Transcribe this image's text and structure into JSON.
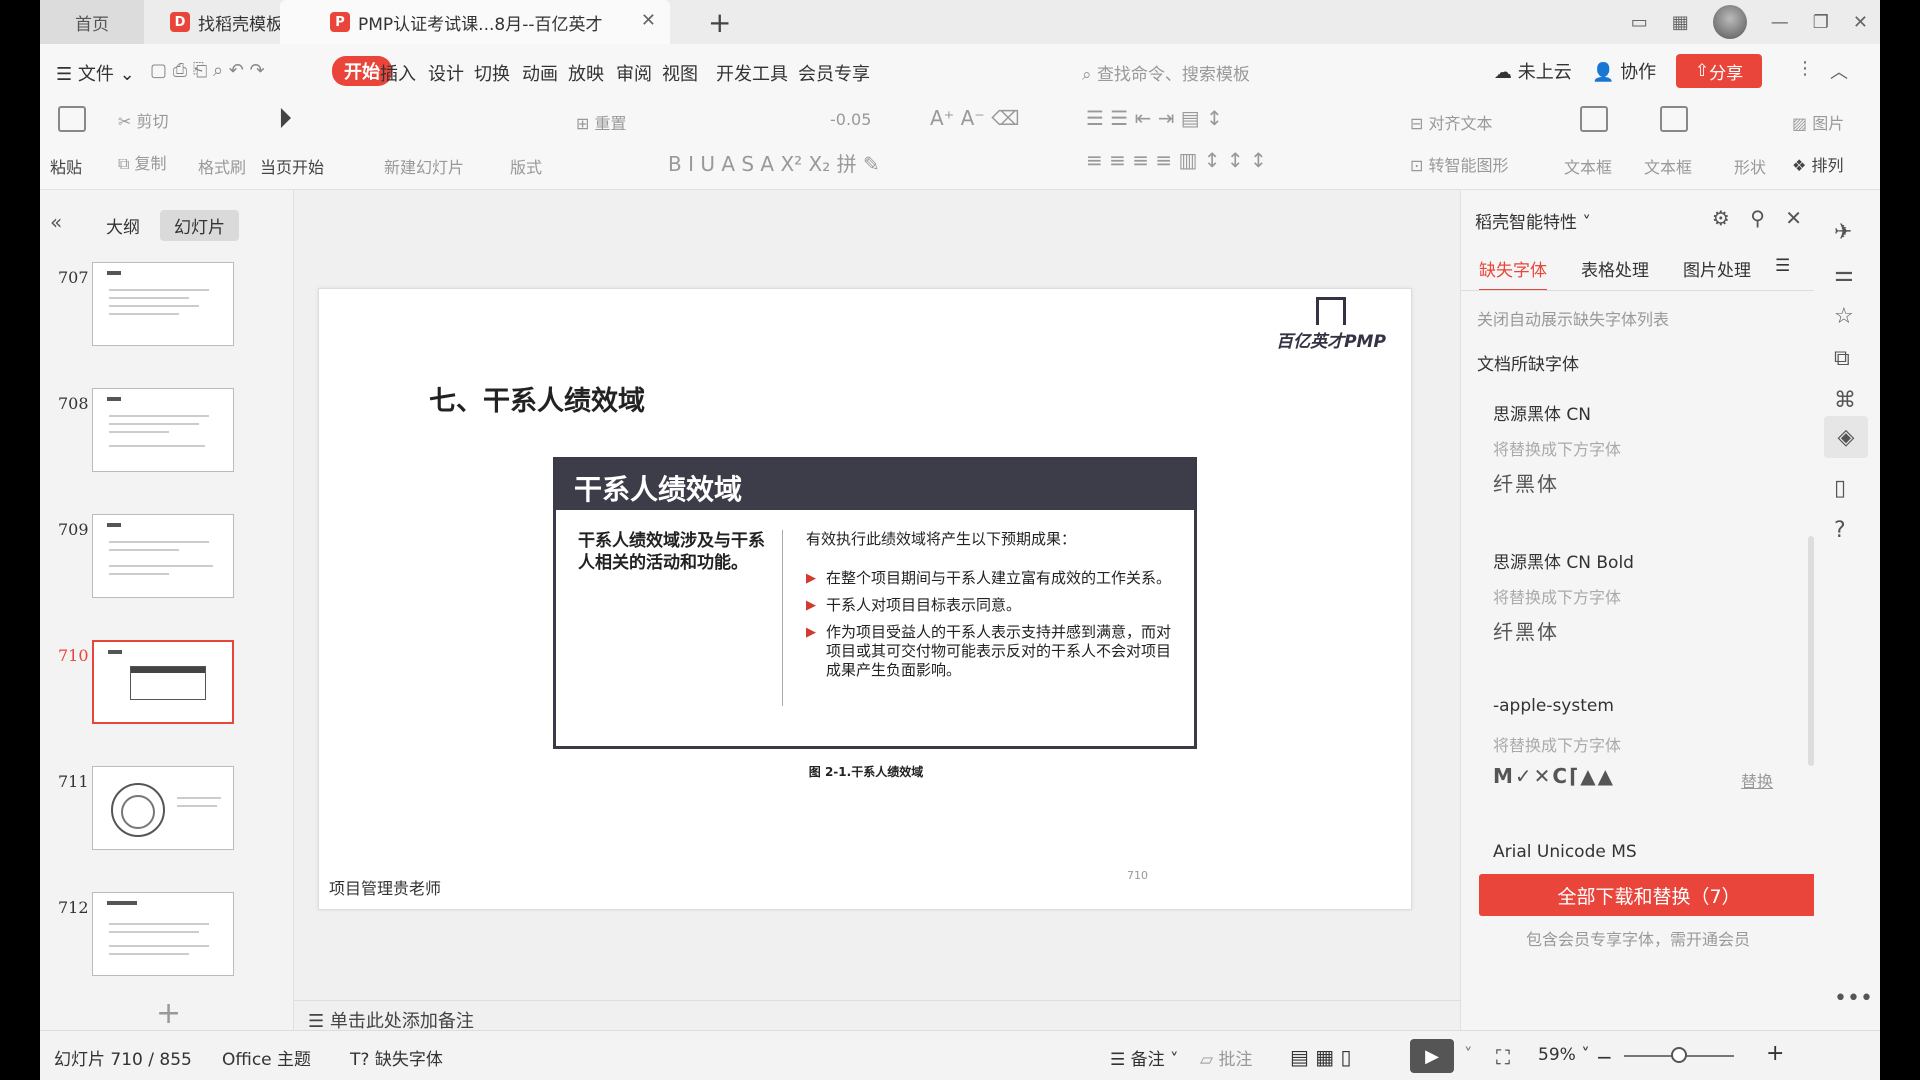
{
  "titlebar": {
    "home_tab": "首页",
    "template_tab": "找稻壳模板",
    "doc_tab": "PMP认证考试课...8月--百亿英才"
  },
  "menubar": {
    "file": "文件",
    "items": [
      "开始",
      "插入",
      "设计",
      "切换",
      "动画",
      "放映",
      "审阅",
      "视图",
      "开发工具",
      "会员专享"
    ],
    "search_placeholder": "查找命令、搜索模板",
    "cloud": "未上云",
    "collab": "协作",
    "share": "分享"
  },
  "ribbon": {
    "paste": "粘贴",
    "cut": "剪切",
    "copy": "复制",
    "format_painter": "格式刷",
    "play_current": "当页开始",
    "new_slide": "新建幻灯片",
    "layout": "版式",
    "reset": "重置",
    "font_size_delta": "-0.05",
    "align_text": "对齐文本",
    "smart_shape": "转智能图形",
    "textbox": "文本框",
    "textbox2": "文本框",
    "shape": "形状",
    "picture": "图片",
    "arrange": "排列"
  },
  "leftpanel": {
    "tab_outline": "大纲",
    "tab_slides": "幻灯片",
    "thumbnails": [
      {
        "num": "707"
      },
      {
        "num": "708"
      },
      {
        "num": "709"
      },
      {
        "num": "710",
        "selected": true
      },
      {
        "num": "711"
      },
      {
        "num": "712"
      }
    ]
  },
  "slide": {
    "logo_text": "百亿英才PMP",
    "title": "七、干系人绩效域",
    "box_header": "干系人绩效域",
    "box_left": "干系人绩效域涉及与干系人相关的活动和功能。",
    "box_intro": "有效执行此绩效域将产生以下预期成果：",
    "bullets": [
      "在整个项目期间与干系人建立富有成效的工作关系。",
      "干系人对项目目标表示同意。",
      "作为项目受益人的干系人表示支持并感到满意，而对项目或其可交付物可能表示反对的干系人不会对项目成果产生负面影响。"
    ],
    "caption": "图 2-1.干系人绩效域",
    "footer": "项目管理贵老师",
    "page_num": "710"
  },
  "notes": {
    "placeholder": "单击此处添加备注"
  },
  "rightpanel": {
    "title": "稻壳智能特性",
    "tabs": [
      "缺失字体",
      "表格处理",
      "图片处理"
    ],
    "close_auto_link": "关闭自动展示缺失字体列表",
    "section_title": "文档所缺字体",
    "fonts": [
      {
        "name": "思源黑体 CN",
        "hint": "将替换成下方字体",
        "replacement": "纤黑体"
      },
      {
        "name": "思源黑体 CN Bold",
        "hint": "将替换成下方字体",
        "replacement": "纤黑体"
      },
      {
        "name": "-apple-system",
        "hint": "将替换成下方字体",
        "replacement": "M✓✕C⌈▲▲",
        "action": "替换"
      },
      {
        "name": "Arial Unicode MS"
      }
    ],
    "download_button": "全部下载和替换（7）",
    "member_note": "包含会员专享字体，需开通会员"
  },
  "statusbar": {
    "slide_info": "幻灯片 710 / 855",
    "theme": "Office 主题",
    "missing_font": "缺失字体",
    "notes": "备注",
    "comments": "批注",
    "zoom": "59%",
    "zoom_level": 0.5
  }
}
